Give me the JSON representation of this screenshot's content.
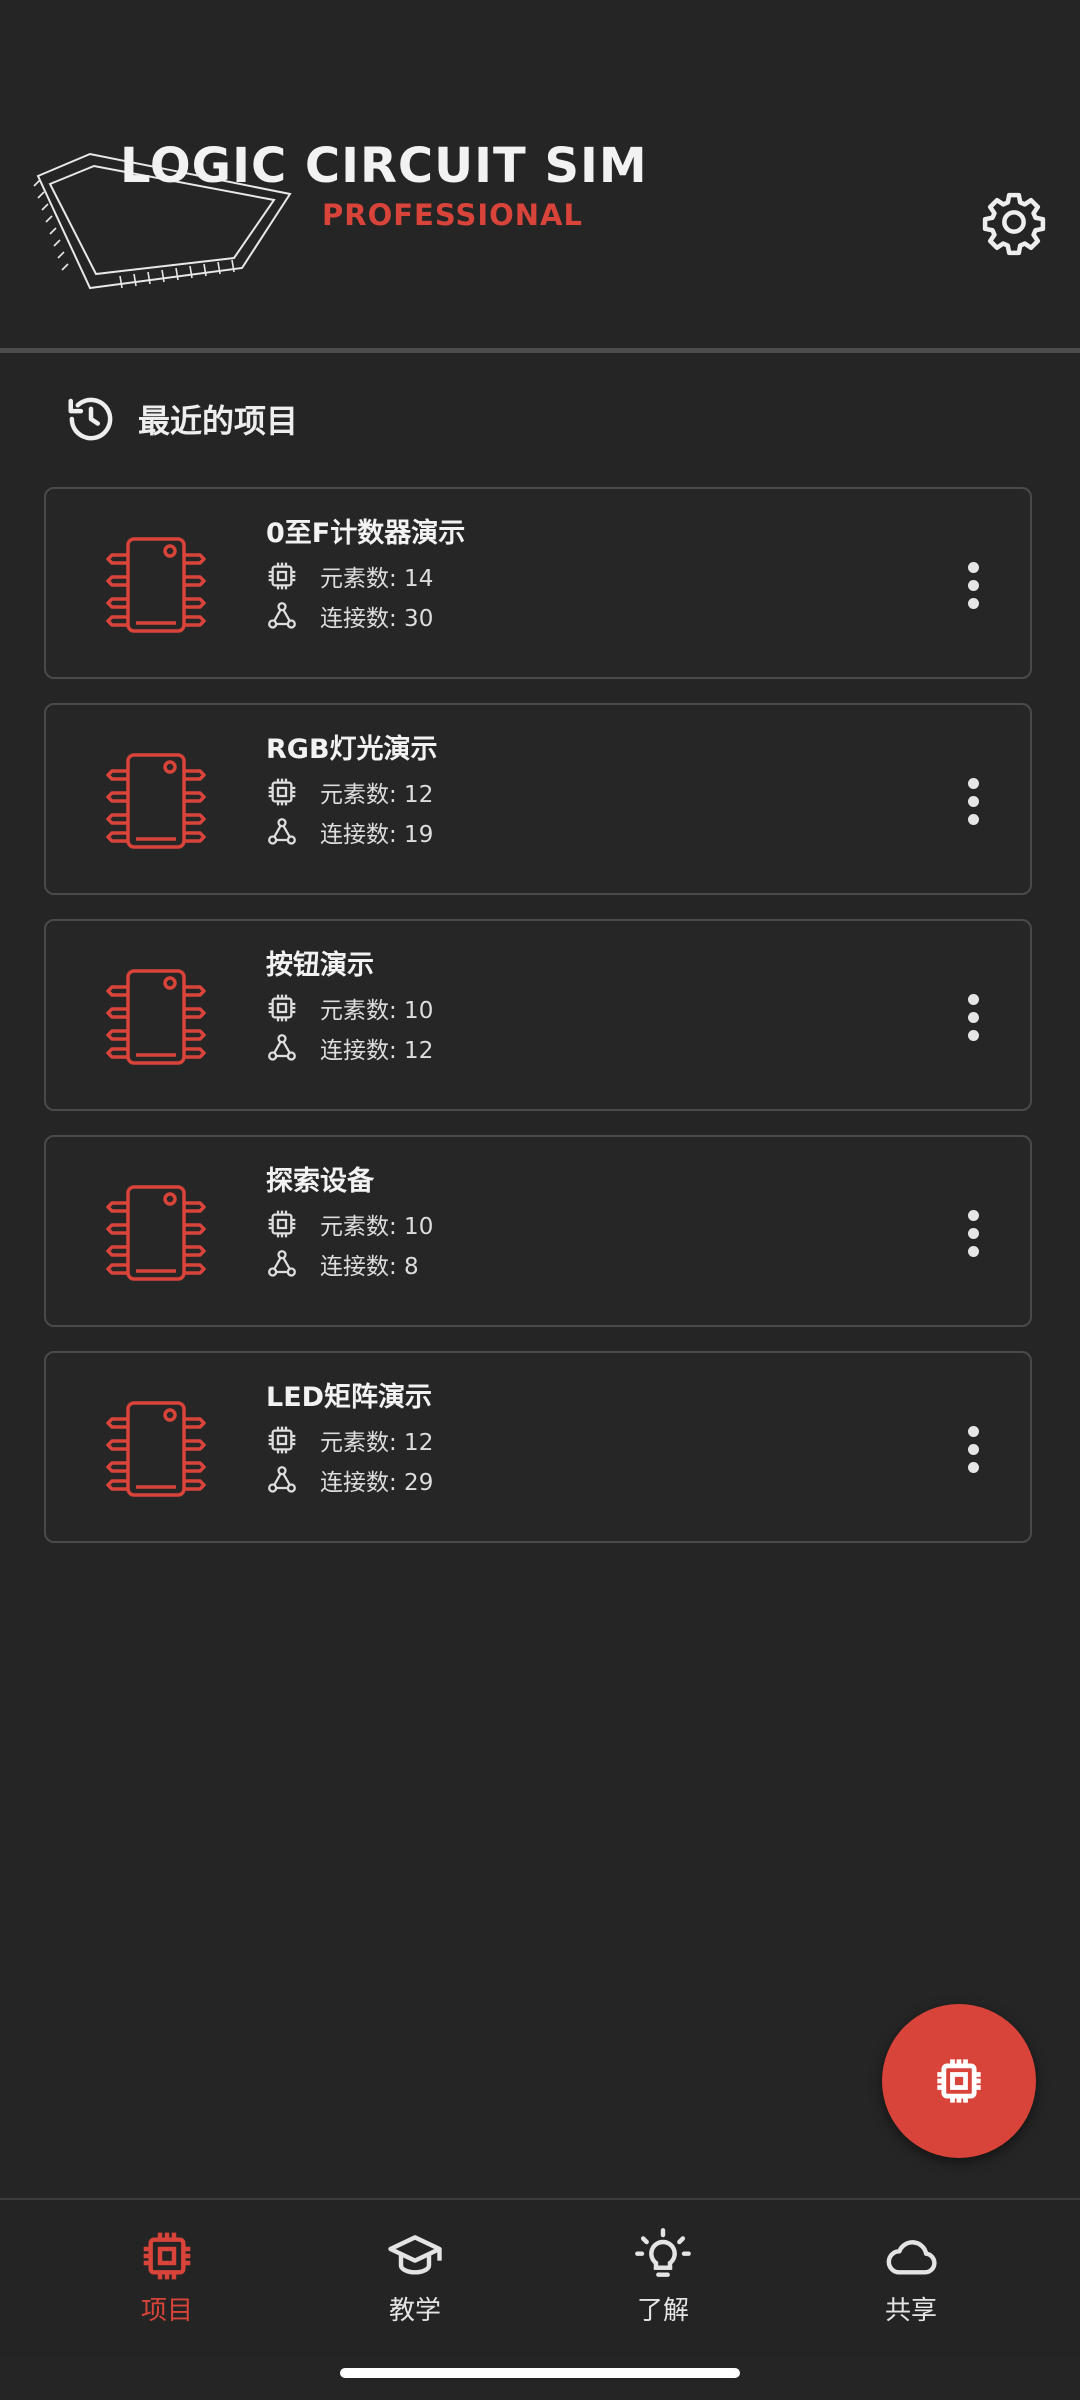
{
  "header": {
    "title": "LOGIC CIRCUIT SIM",
    "subtitle": "PROFESSIONAL",
    "settings_icon": "gear-icon"
  },
  "recent": {
    "icon": "history-icon",
    "title": "最近的项目"
  },
  "projects": [
    {
      "name": "0至F计数器演示",
      "elements": "元素数: 14",
      "connections": "连接数: 30"
    },
    {
      "name": "RGB灯光演示",
      "elements": "元素数: 12",
      "connections": "连接数: 19"
    },
    {
      "name": "按钮演示",
      "elements": "元素数: 10",
      "connections": "连接数: 12"
    },
    {
      "name": "探索设备",
      "elements": "元素数: 10",
      "connections": "连接数: 8"
    },
    {
      "name": "LED矩阵演示",
      "elements": "元素数: 12",
      "connections": "连接数: 29"
    }
  ],
  "fab": {
    "icon": "chip-icon"
  },
  "nav": {
    "items": [
      {
        "label": "项目",
        "icon": "chip-icon",
        "active": true
      },
      {
        "label": "教学",
        "icon": "graduation-cap-icon",
        "active": false
      },
      {
        "label": "了解",
        "icon": "lightbulb-icon",
        "active": false
      },
      {
        "label": "共享",
        "icon": "cloud-icon",
        "active": false
      }
    ]
  },
  "colors": {
    "background": "#252525",
    "accent": "#d9443a",
    "text": "#eeeeee",
    "border": "#4a4a4a"
  }
}
